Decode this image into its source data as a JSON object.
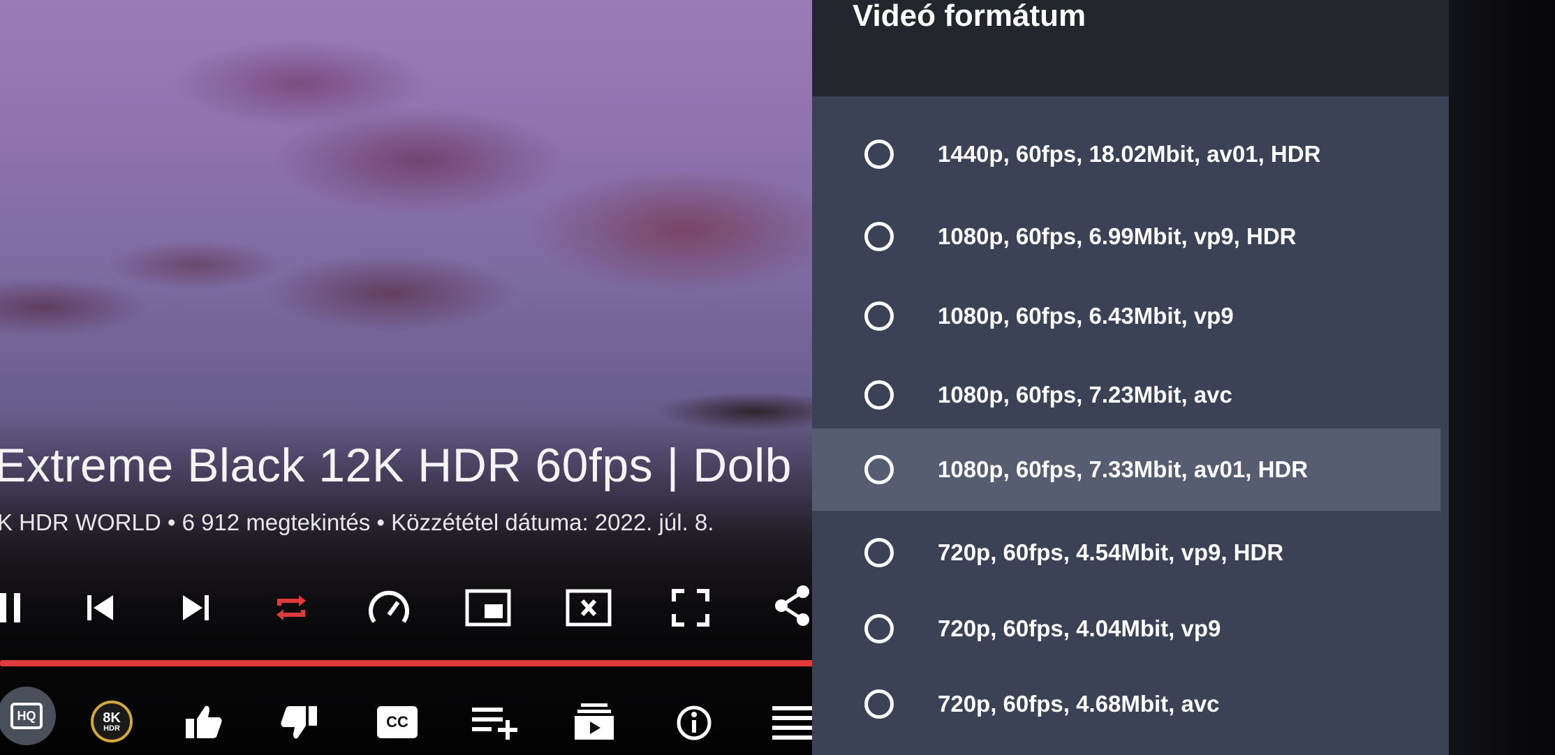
{
  "video": {
    "title": "Extreme Black 12K HDR 60fps | Dolb",
    "meta": "K HDR WORLD • 6 912 megtekintés • Közzététel dátuma: 2022. júl. 8.",
    "progress_percent": 100
  },
  "controls": {
    "row1": [
      "pause-icon",
      "previous-icon",
      "next-icon",
      "repeat-icon",
      "playback-speed-icon",
      "picture-in-picture-icon",
      "close-video-icon",
      "fullscreen-icon",
      "share-icon"
    ],
    "row2": [
      "hq-icon",
      "8k-hdr-badge-icon",
      "like-icon",
      "dislike-icon",
      "closed-captions-icon",
      "add-to-playlist-icon",
      "subscriptions-icon",
      "info-icon",
      "menu-icon"
    ],
    "hq_label": "HQ",
    "badge_top": "8K",
    "badge_bottom": "HDR",
    "cc_label": "CC",
    "accent_color": "#e03a3a"
  },
  "panel": {
    "title": "Videó formátum",
    "options": [
      {
        "label": "1440p, 60fps, 18.02Mbit, av01, HDR",
        "selected": false
      },
      {
        "label": "1080p, 60fps, 6.99Mbit, vp9, HDR",
        "selected": false
      },
      {
        "label": "1080p, 60fps, 6.43Mbit, vp9",
        "selected": false
      },
      {
        "label": "1080p, 60fps, 7.23Mbit, avc",
        "selected": false
      },
      {
        "label": "1080p, 60fps, 7.33Mbit, av01, HDR",
        "selected": true
      },
      {
        "label": "720p, 60fps, 4.54Mbit, vp9, HDR",
        "selected": false
      },
      {
        "label": "720p, 60fps, 4.04Mbit, vp9",
        "selected": false
      },
      {
        "label": "720p, 60fps, 4.68Mbit, avc",
        "selected": false
      }
    ]
  }
}
